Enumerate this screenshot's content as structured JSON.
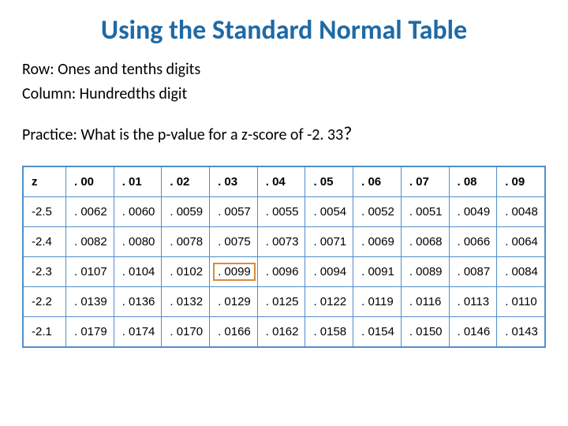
{
  "title": "Using the Standard Normal Table",
  "lines": {
    "row": "Row: Ones and tenths digits",
    "column": "Column: Hundredths digit",
    "practice_pre": "Practice: What is the p-value for a z-score of -2. 33",
    "practice_q": "?"
  },
  "table": {
    "z_label": "z",
    "col_headers": [
      ". 00",
      ". 01",
      ". 02",
      ". 03",
      ". 04",
      ". 05",
      ". 06",
      ". 07",
      ". 08",
      ". 09"
    ],
    "rows": [
      {
        "z": "-2.5",
        "cells": [
          ". 0062",
          ". 0060",
          ". 0059",
          ". 0057",
          ". 0055",
          ". 0054",
          ". 0052",
          ". 0051",
          ". 0049",
          ". 0048"
        ]
      },
      {
        "z": "-2.4",
        "cells": [
          ". 0082",
          ". 0080",
          ". 0078",
          ". 0075",
          ". 0073",
          ". 0071",
          ". 0069",
          ". 0068",
          ". 0066",
          ". 0064"
        ]
      },
      {
        "z": "-2.3",
        "cells": [
          ". 0107",
          ". 0104",
          ". 0102",
          ". 0099",
          ". 0096",
          ". 0094",
          ". 0091",
          ". 0089",
          ". 0087",
          ". 0084"
        ]
      },
      {
        "z": "-2.2",
        "cells": [
          ". 0139",
          ". 0136",
          ". 0132",
          ". 0129",
          ". 0125",
          ". 0122",
          ". 0119",
          ". 0116",
          ". 0113",
          ". 0110"
        ]
      },
      {
        "z": "-2.1",
        "cells": [
          ". 0179",
          ". 0174",
          ". 0170",
          ". 0166",
          ". 0162",
          ". 0158",
          ". 0154",
          ". 0150",
          ". 0146",
          ". 0143"
        ]
      }
    ],
    "highlight": {
      "row": 2,
      "col": 3
    }
  }
}
